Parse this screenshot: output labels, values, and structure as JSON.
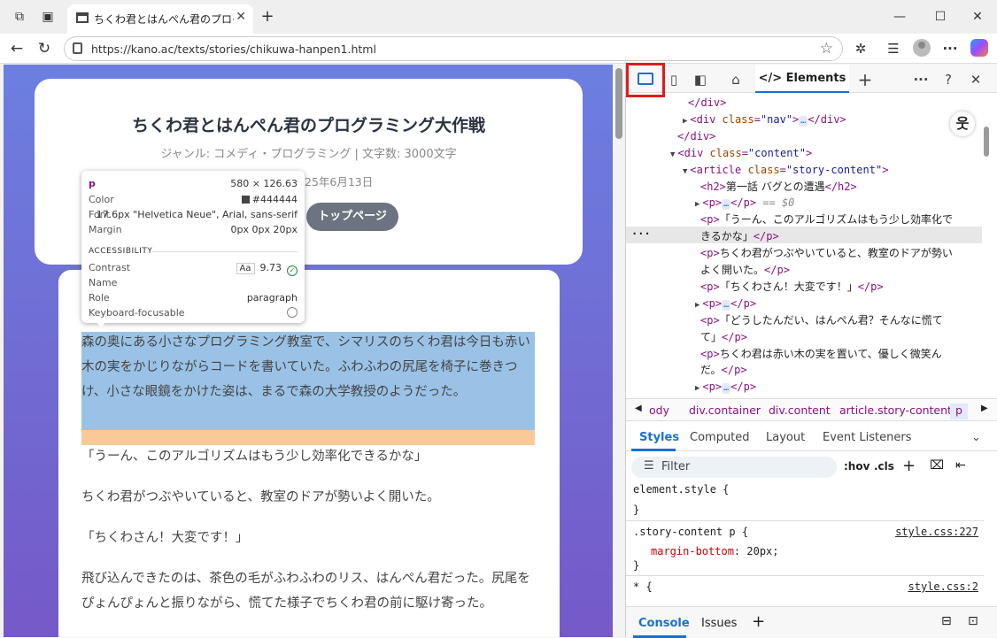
{
  "browser": {
    "tab_title": "ちくわ君とはんぺん君のプログラミング大",
    "url": "https://kano.ac/texts/stories/chikuwa-hanpen1.html"
  },
  "page": {
    "title": "ちくわ君とはんぺん君のプログラミング大作戦",
    "meta": "ジャンル: コメディ・プログラミング | 文字数: 3000文字",
    "date_partial": "25年6月13日",
    "top_button": "トップページ",
    "paragraphs": [
      "森の奥にある小さなプログラミング教室で、シマリスのちくわ君は今日も赤い木の実をかじりながらコードを書いていた。ふわふわの尻尾を椅子に巻きつけ、小さな眼鏡をかけた姿は、まるで森の大学教授のようだった。",
      "「うーん、このアルゴリズムはもう少し効率化できるかな」",
      "ちくわ君がつぶやいていると、教室のドアが勢いよく開いた。",
      "「ちくわさん！大変です！」",
      "飛び込んできたのは、茶色の毛がふわふわのリス、はんぺん君だった。尻尾をぴょんぴょんと振りながら、慌てた様子でちくわ君の前に駆け寄った。"
    ]
  },
  "tooltip": {
    "tag": "p",
    "dims": "580 × 126.63",
    "color_label": "Color",
    "color_value": "#444444",
    "font_label": "Font",
    "font_value": "17.6px \"Helvetica Neue\", Arial, sans-serif",
    "margin_label": "Margin",
    "margin_value": "0px 0px 20px",
    "section": "ACCESSIBILITY",
    "contrast_label": "Contrast",
    "contrast_aa": "Aa",
    "contrast_value": "9.73",
    "name_label": "Name",
    "role_label": "Role",
    "role_value": "paragraph",
    "focus_label": "Keyboard-focusable"
  },
  "devtools": {
    "elements_tab": "Elements",
    "dom": [
      {
        "indent": 70,
        "tri": "",
        "tag": "</div>",
        "text": ""
      },
      {
        "indent": 64,
        "tri": "▶",
        "open": "<div",
        "attr": "class",
        "val": "\"nav\"",
        "close": ">",
        "ell": "…",
        "end": "</div>"
      },
      {
        "indent": 58,
        "tri": "",
        "tag": "</div>",
        "text": ""
      },
      {
        "indent": 50,
        "tri": "▼",
        "open": "<div",
        "attr": "class",
        "val": "\"content\"",
        "close": ">",
        "ell": "",
        "end": ""
      },
      {
        "indent": 64,
        "tri": "▼",
        "open": "<article",
        "attr": "class",
        "val": "\"story-content\"",
        "close": ">",
        "ell": "",
        "end": ""
      },
      {
        "indent": 84,
        "tri": "",
        "open": "<h2>",
        "attr": "",
        "val": "",
        "close": "",
        "text": "第一話 バグとの遭遇",
        "end": "</h2>"
      },
      {
        "indent": 78,
        "tri": "▶",
        "open": "<p>",
        "attr": "",
        "val": "",
        "close": "",
        "ell": "…",
        "end": "</p>",
        "eq": "== $0"
      },
      {
        "indent": 84,
        "tri": "",
        "open": "<p>",
        "text": "「うーん、このアルゴリズムはもう少し効率化で",
        "end": ""
      },
      {
        "indent": 84,
        "tri": "",
        "open": "",
        "text": "きるかな」",
        "end": "</p>"
      },
      {
        "indent": 84,
        "tri": "",
        "open": "<p>",
        "text": "ちくわ君がつぶやいていると、教室のドアが勢い",
        "end": ""
      },
      {
        "indent": 84,
        "tri": "",
        "open": "",
        "text": "よく開いた。",
        "end": "</p>"
      },
      {
        "indent": 84,
        "tri": "",
        "open": "<p>",
        "text": "「ちくわさん！大変です！」",
        "end": "</p>"
      },
      {
        "indent": 78,
        "tri": "▶",
        "open": "<p>",
        "ell": "…",
        "end": "</p>"
      },
      {
        "indent": 84,
        "tri": "",
        "open": "<p>",
        "text": "「どうしたんだい、はんぺん君？そんなに慌て",
        "end": ""
      },
      {
        "indent": 84,
        "tri": "",
        "open": "",
        "text": "て」",
        "end": "</p>"
      },
      {
        "indent": 84,
        "tri": "",
        "open": "<p>",
        "text": "ちくわ君は赤い木の実を置いて、優しく微笑ん",
        "end": ""
      },
      {
        "indent": 84,
        "tri": "",
        "open": "",
        "text": "だ。",
        "end": "</p>"
      },
      {
        "indent": 78,
        "tri": "▶",
        "open": "<p>",
        "ell": "…",
        "end": "</p>"
      }
    ],
    "breadcrumbs": [
      "ody",
      "div.container",
      "div.content",
      "article.story-content",
      "p"
    ],
    "styles_tabs": [
      "Styles",
      "Computed",
      "Layout",
      "Event Listeners"
    ],
    "filter_placeholder": "Filter",
    "hov": ":hov",
    "cls": ".cls",
    "rules": {
      "element_style": "element.style {",
      "close": "}",
      "story_selector": ".story-content p {",
      "story_prop": "margin-bottom",
      "story_val": "20px;",
      "story_src": "style.css:227",
      "star_selector": "* {",
      "star_src": "style.css:2"
    },
    "drawer_tabs": [
      "Console",
      "Issues"
    ]
  }
}
